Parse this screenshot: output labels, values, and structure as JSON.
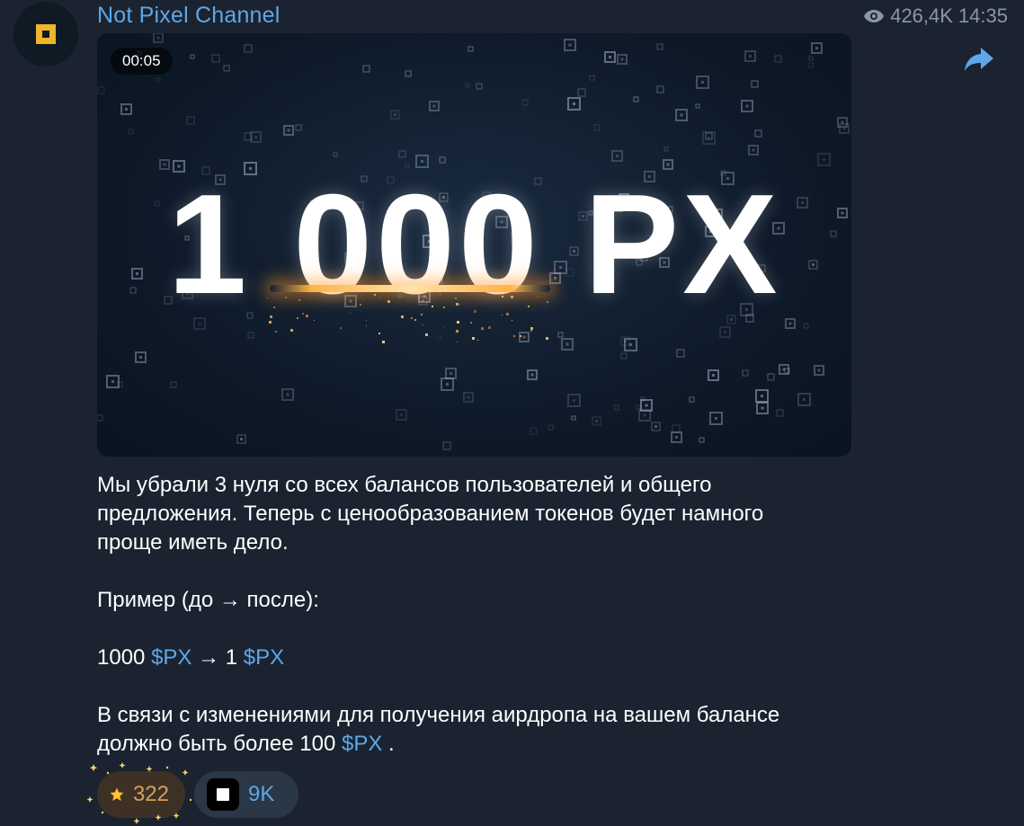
{
  "channel": {
    "name": "Not Pixel Channel",
    "avatar_icon": "not-pixel-logo-icon",
    "accent_color": "#f0b429"
  },
  "meta": {
    "views": "426,4K",
    "time": "14:35",
    "views_icon": "eye-icon",
    "forward_icon": "forward-arrow-icon"
  },
  "video": {
    "duration": "00:05",
    "title": "1 000 PX"
  },
  "post": {
    "paragraph1": "Мы убрали 3 нуля со всех балансов пользователей и общего предложения. Теперь с ценообразованием токенов будет намного проще иметь дело.",
    "example_label": "Пример (до → после):",
    "example_before_amount": "1000",
    "example_before_token": "$PX",
    "example_arrow": "→ 1",
    "example_after_token": "$PX",
    "airdrop_text": "В связи с изменениями для получения аирдропа на вашем балансе должно быть более 100",
    "airdrop_token": "$PX",
    "airdrop_end": "."
  },
  "reactions": [
    {
      "icon": "star-icon",
      "count": "322",
      "color": "#d6a056"
    },
    {
      "icon": "not-pixel-reaction-icon",
      "count": "9K",
      "color": "#5ea7e8"
    }
  ],
  "colors": {
    "background": "#1b2330",
    "link": "#5ea7e8",
    "text": "#ffffff",
    "muted": "#8b96a3"
  }
}
